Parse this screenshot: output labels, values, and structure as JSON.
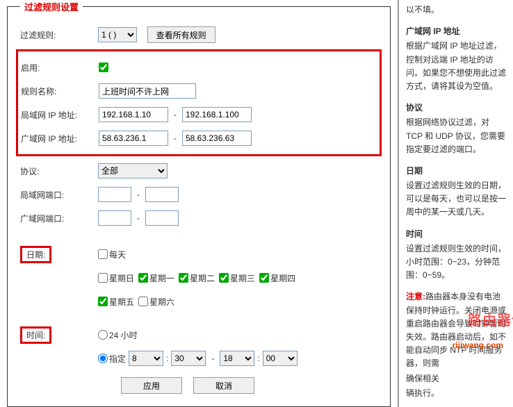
{
  "legend": "过滤规则设置",
  "labels": {
    "filter_rule": "过滤规则:",
    "enable": "启用:",
    "rule_name": "规则名称:",
    "lan_ip": "局域网 IP 地址:",
    "wan_ip": "广域网 IP 地址:",
    "protocol": "协议:",
    "lan_port": "局域网端口:",
    "wan_port": "广域网端口:",
    "date": "日期:",
    "time": "时间:"
  },
  "rule_select": "1 ( )",
  "view_all_btn": "查看所有规则",
  "rule_name_value": "上班时间不许上网",
  "lan_ip_from": "192.168.1.10",
  "lan_ip_to": "192.168.1.100",
  "wan_ip_from": "58.63.236.1",
  "wan_ip_to": "58.63.236.63",
  "protocol_value": "全部",
  "days": {
    "everyday": "每天",
    "sun": "星期日",
    "mon": "星期一",
    "tue": "星期二",
    "wed": "星期三",
    "thu": "星期四",
    "fri": "星期五",
    "sat": "星期六"
  },
  "time_opts": {
    "all_day": "24 小时",
    "specify": "指定",
    "h1": "8",
    "m1": "30",
    "h2": "18",
    "m2": "00"
  },
  "apply_btn": "应用",
  "cancel_btn": "取消",
  "side": {
    "top": "以不填。",
    "h1": "广域网 IP 地址",
    "p1": "根据广域网 IP 地址过滤，控制对远端 IP 地址的访问。如果您不想使用此过滤方式，请将其设为空值。",
    "h2": "协议",
    "p2": "根据网络协议过滤，对 TCP 和 UDP 协议，您需要指定要过滤的端口。",
    "h3": "日期",
    "p3": "设置过滤规则生效的日期，可以是每天，也可以是按一周中的某一天或几天。",
    "h4": "时间",
    "p4": "设置过滤规则生效的时间，小时范围：0~23，分钟范围：0~59。",
    "note_label": "注意:",
    "note": "路由器本身没有电池保持时钟运行。关闭电源或重启路由器会导致时钟暂时失效。路由器启动后，如不能自动同步 NTP 时间服务器，则需",
    "note2": "确保相关",
    "note3": "辆执行。"
  },
  "watermark": "路由器设置",
  "brand": "rijiwang.com"
}
